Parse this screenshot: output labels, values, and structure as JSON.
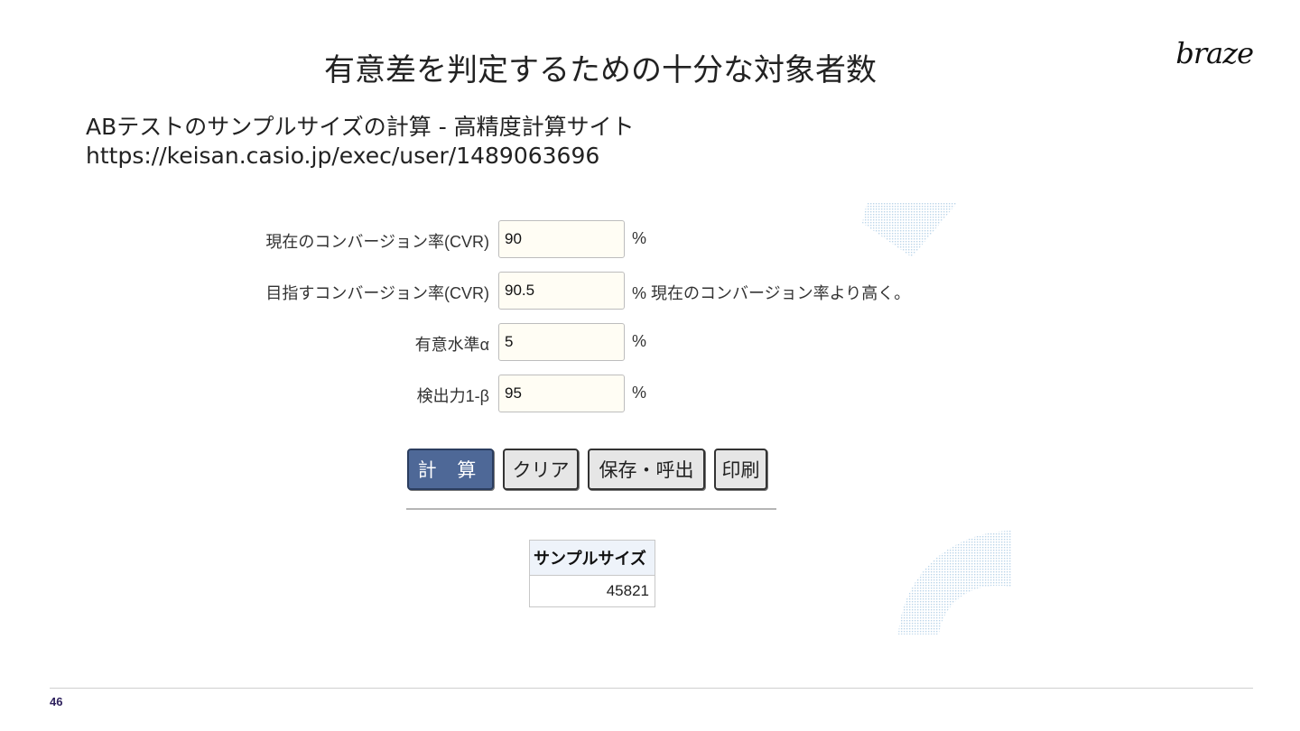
{
  "slide": {
    "title": "有意差を判定するための十分な対象者数",
    "logo": "braze",
    "subtitle_line1": "ABテストのサンプルサイズの計算 - 高精度計算サイト",
    "subtitle_line2": "https://keisan.casio.jp/exec/user/1489063696",
    "page_number": "46"
  },
  "form": {
    "current_cvr": {
      "label": "現在のコンバージョン率(CVR)",
      "value": "90",
      "unit": "%"
    },
    "target_cvr": {
      "label": "目指すコンバージョン率(CVR)",
      "value": "90.5",
      "unit": "% 現在のコンバージョン率より高く。"
    },
    "alpha": {
      "label": "有意水準α",
      "value": "5",
      "unit": "%"
    },
    "power": {
      "label": "検出力1-β",
      "value": "95",
      "unit": "%"
    }
  },
  "buttons": {
    "calculate": "計 算",
    "clear": "クリア",
    "save_load": "保存・呼出",
    "print": "印刷"
  },
  "result": {
    "header": "サンプルサイズ",
    "value": "45821"
  }
}
